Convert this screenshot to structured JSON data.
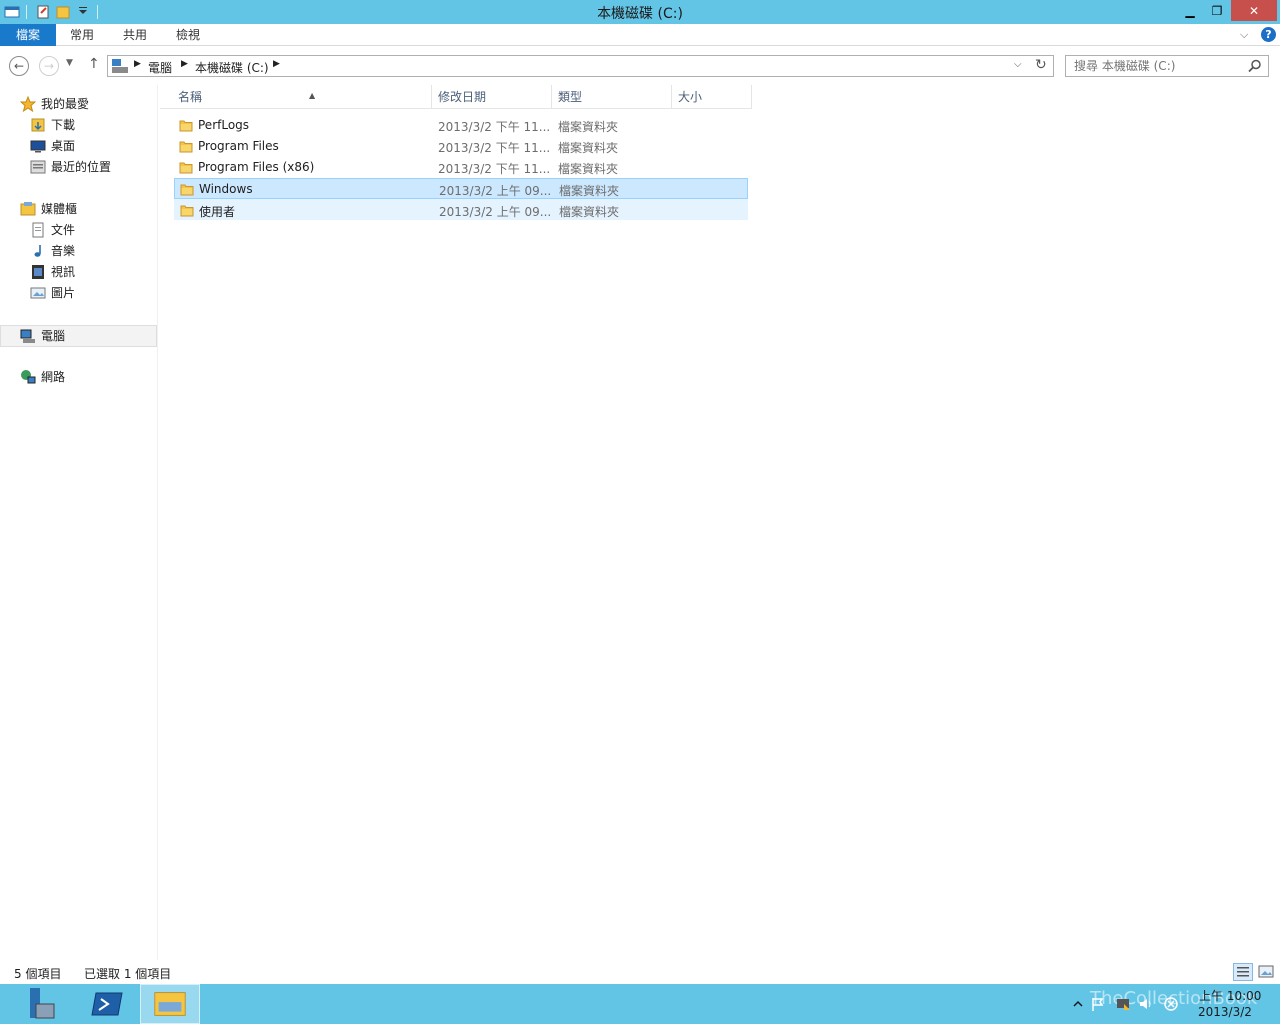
{
  "window": {
    "title": "本機磁碟 (C:)"
  },
  "ribbon": {
    "tabs": [
      "檔案",
      "常用",
      "共用",
      "檢視"
    ],
    "help": "?"
  },
  "address": {
    "breadcrumbs": [
      "電腦",
      "本機磁碟 (C:)"
    ]
  },
  "search": {
    "placeholder": "搜尋 本機磁碟 (C:)"
  },
  "nav_pane": {
    "favorites_label": "我的最愛",
    "favorites": [
      "下載",
      "桌面",
      "最近的位置"
    ],
    "libraries_label": "媒體櫃",
    "libraries": [
      "文件",
      "音樂",
      "視訊",
      "圖片"
    ],
    "computer_label": "電腦",
    "network_label": "網路"
  },
  "columns": {
    "name": "名稱",
    "modified": "修改日期",
    "type": "類型",
    "size": "大小"
  },
  "files": [
    {
      "name": "PerfLogs",
      "modified": "2013/3/2 下午 11...",
      "type": "檔案資料夾"
    },
    {
      "name": "Program Files",
      "modified": "2013/3/2 下午 11...",
      "type": "檔案資料夾"
    },
    {
      "name": "Program Files (x86)",
      "modified": "2013/3/2 下午 11...",
      "type": "檔案資料夾"
    },
    {
      "name": "Windows",
      "modified": "2013/3/2 上午 09...",
      "type": "檔案資料夾",
      "selected": true
    },
    {
      "name": "使用者",
      "modified": "2013/3/2 上午 09...",
      "type": "檔案資料夾",
      "hover": true
    }
  ],
  "status": {
    "count": "5 個項目",
    "selected": "已選取 1 個項目"
  },
  "taskbar": {
    "clock_time": "上午 10:00",
    "clock_date": "2013/3/2",
    "watermark": "TheCollectionBook"
  },
  "colors": {
    "titlebar": "#63c5e6",
    "file_tab": "#1979ca",
    "selection": "#cce8ff",
    "close_button": "#c7504c"
  },
  "icons": {
    "folder": "folder-icon",
    "back": "back-arrow-icon",
    "forward": "forward-arrow-icon",
    "up": "up-arrow-icon",
    "refresh": "refresh-icon",
    "search": "search-icon"
  }
}
